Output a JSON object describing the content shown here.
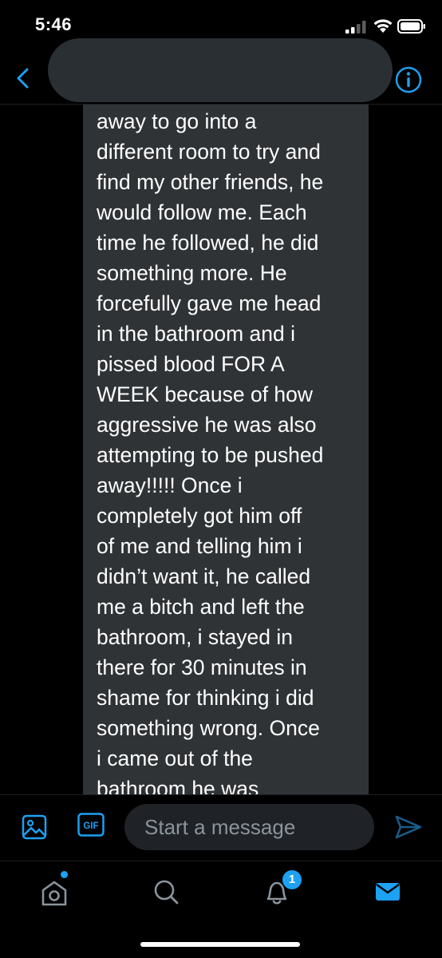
{
  "status_bar": {
    "time": "5:46"
  },
  "header": {
    "back_icon": "chevron-left-icon",
    "info_icon": "info-circle-icon"
  },
  "conversation": {
    "message_lines": [
      "away to go into a",
      "different room to try and",
      "find my other friends, he",
      "would follow me. Each",
      "time he followed, he did",
      "something more. He",
      "forcefully gave me head",
      "in the bathroom and i",
      "pissed blood FOR A",
      "WEEK because of how",
      "aggressive he was also",
      "attempting to be pushed",
      "away!!!!! Once i",
      "completely got him off",
      "of me and telling him i",
      "didn’t want it, he called",
      "me a bitch and left the",
      "bathroom, i stayed in",
      "there for 30 minutes in",
      "shame for thinking i did",
      "something wrong. Once",
      "i came out of the",
      "bathroom he was"
    ]
  },
  "composer": {
    "media_icon": "image-icon",
    "gif_label": "GIF",
    "placeholder": "Start a message",
    "send_icon": "send-icon"
  },
  "tab_bar": {
    "home_icon": "home-icon",
    "search_icon": "search-icon",
    "notifications_icon": "bell-icon",
    "notifications_count": "1",
    "messages_icon": "mail-icon"
  },
  "colors": {
    "accent": "#1da1f2",
    "bubble": "#2f3336",
    "background": "#000000"
  }
}
